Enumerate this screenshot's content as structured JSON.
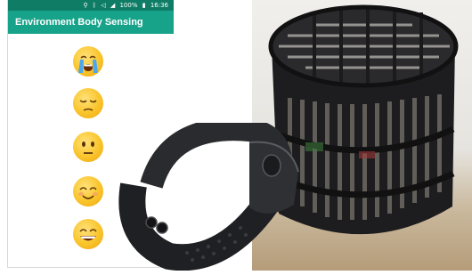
{
  "status_bar": {
    "icons": [
      "location-icon",
      "bluetooth-icon",
      "mute-icon",
      "signal-icon",
      "battery-icon"
    ],
    "battery": "100%",
    "time": "16:36"
  },
  "app_bar": {
    "title": "Environment Body Sensing"
  },
  "emoji_scale": [
    "crying-face-icon",
    "pensive-face-icon",
    "neutral-face-icon",
    "smiling-face-icon",
    "grinning-face-icon"
  ],
  "colors": {
    "status_bar": "#0f7d66",
    "app_bar": "#17a38a",
    "emoji_yellow": "#f9c42a"
  },
  "photos": [
    "black-wristband-device",
    "black-cylindrical-cage-sensor"
  ]
}
